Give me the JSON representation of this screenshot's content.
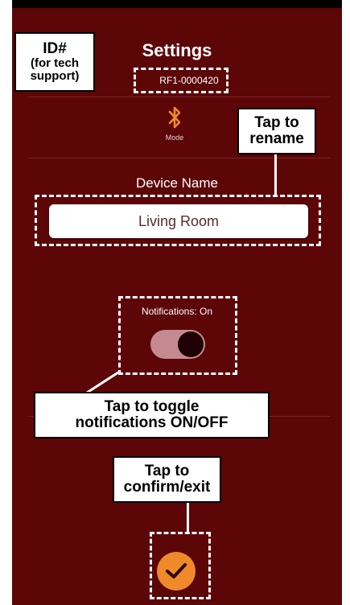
{
  "app": {
    "title": "Settings",
    "device_id": "RF1-0000420",
    "mode_label": "Mode",
    "mode_icon": "bluetooth-icon",
    "device_name_label": "Device Name",
    "device_name_value": "Living Room",
    "notifications_label": "Notifications: On",
    "notifications_on": true,
    "confirm_icon": "checkmark-icon",
    "colors": {
      "background": "#5c0608",
      "accent": "#ee8a2a",
      "toggle_track": "#c48a8f"
    }
  },
  "annotations": {
    "id_title": "ID#",
    "id_subtitle_1": "(for tech",
    "id_subtitle_2": "support)",
    "rename_line1": "Tap to",
    "rename_line2": "rename",
    "toggle_line1": "Tap to toggle",
    "toggle_line2": "notifications ON/OFF",
    "confirm_line1": "Tap to",
    "confirm_line2": "confirm/exit"
  }
}
